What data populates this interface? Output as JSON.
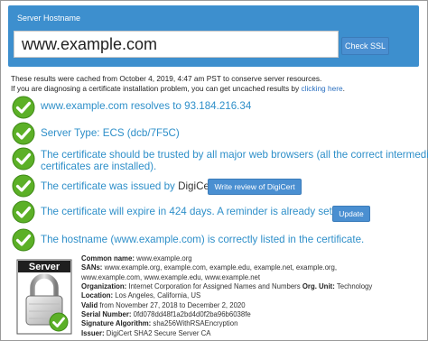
{
  "header": {
    "title": "Server Hostname",
    "hostname_value": "www.example.com",
    "check_button": "Check SSL"
  },
  "cache_note": {
    "line1": "These results were cached from October 4, 2019, 4:47 am PST to conserve server resources.",
    "line2_prefix": "If you are diagnosing a certificate installation problem, you can get uncached results by",
    "line2_link": "clicking here",
    "line2_suffix": "."
  },
  "results": [
    {
      "text": "www.example.com resolves to 93.184.216.34"
    },
    {
      "text": "Server Type: ECS (dcb/7F5C)"
    },
    {
      "text": "The certificate should be trusted by all major web browsers (all the correct intermediate",
      "text2": "certificates are installed)."
    },
    {
      "text": "The certificate was issued by",
      "issuer": "DigiCert",
      "suffix": ".",
      "button": "Write review of DigiCert"
    },
    {
      "text": "The certificate will expire in 424 days. A reminder is already set up.",
      "button": "Update"
    },
    {
      "text": "The hostname (www.example.com) is correctly listed in the certificate."
    }
  ],
  "certificate": {
    "graphic_label": "Server",
    "common_name_label": "Common name:",
    "common_name": "www.example.org",
    "sans_label": "SANs:",
    "sans_line1": "www.example.org, example.com, example.edu, example.net, example.org,",
    "sans_line2": "www.example.com, www.example.edu, www.example.net",
    "org_label": "Organization:",
    "org": "Internet Corporation for Assigned Names and Numbers",
    "org_unit_label": "Org. Unit:",
    "org_unit": "Technology",
    "location_label": "Location:",
    "location": "Los Angeles, California, US",
    "valid_label": "Valid",
    "valid": "from November 27, 2018 to December 2, 2020",
    "serial_label": "Serial Number:",
    "serial": "0fd078dd48f1a2bd4d0f2ba96b6038fe",
    "sigalg_label": "Signature Algorithm:",
    "sigalg": "sha256WithRSAEncryption",
    "issuer_label": "Issuer:",
    "issuer": "DigiCert SHA2 Secure Server CA"
  },
  "colors": {
    "accent": "#3d8fce",
    "result_text": "#2e8fc9",
    "check_green": "#5cb027",
    "button": "#4a8fd1"
  },
  "icons": [
    "green-check-icon",
    "padlock-icon"
  ]
}
